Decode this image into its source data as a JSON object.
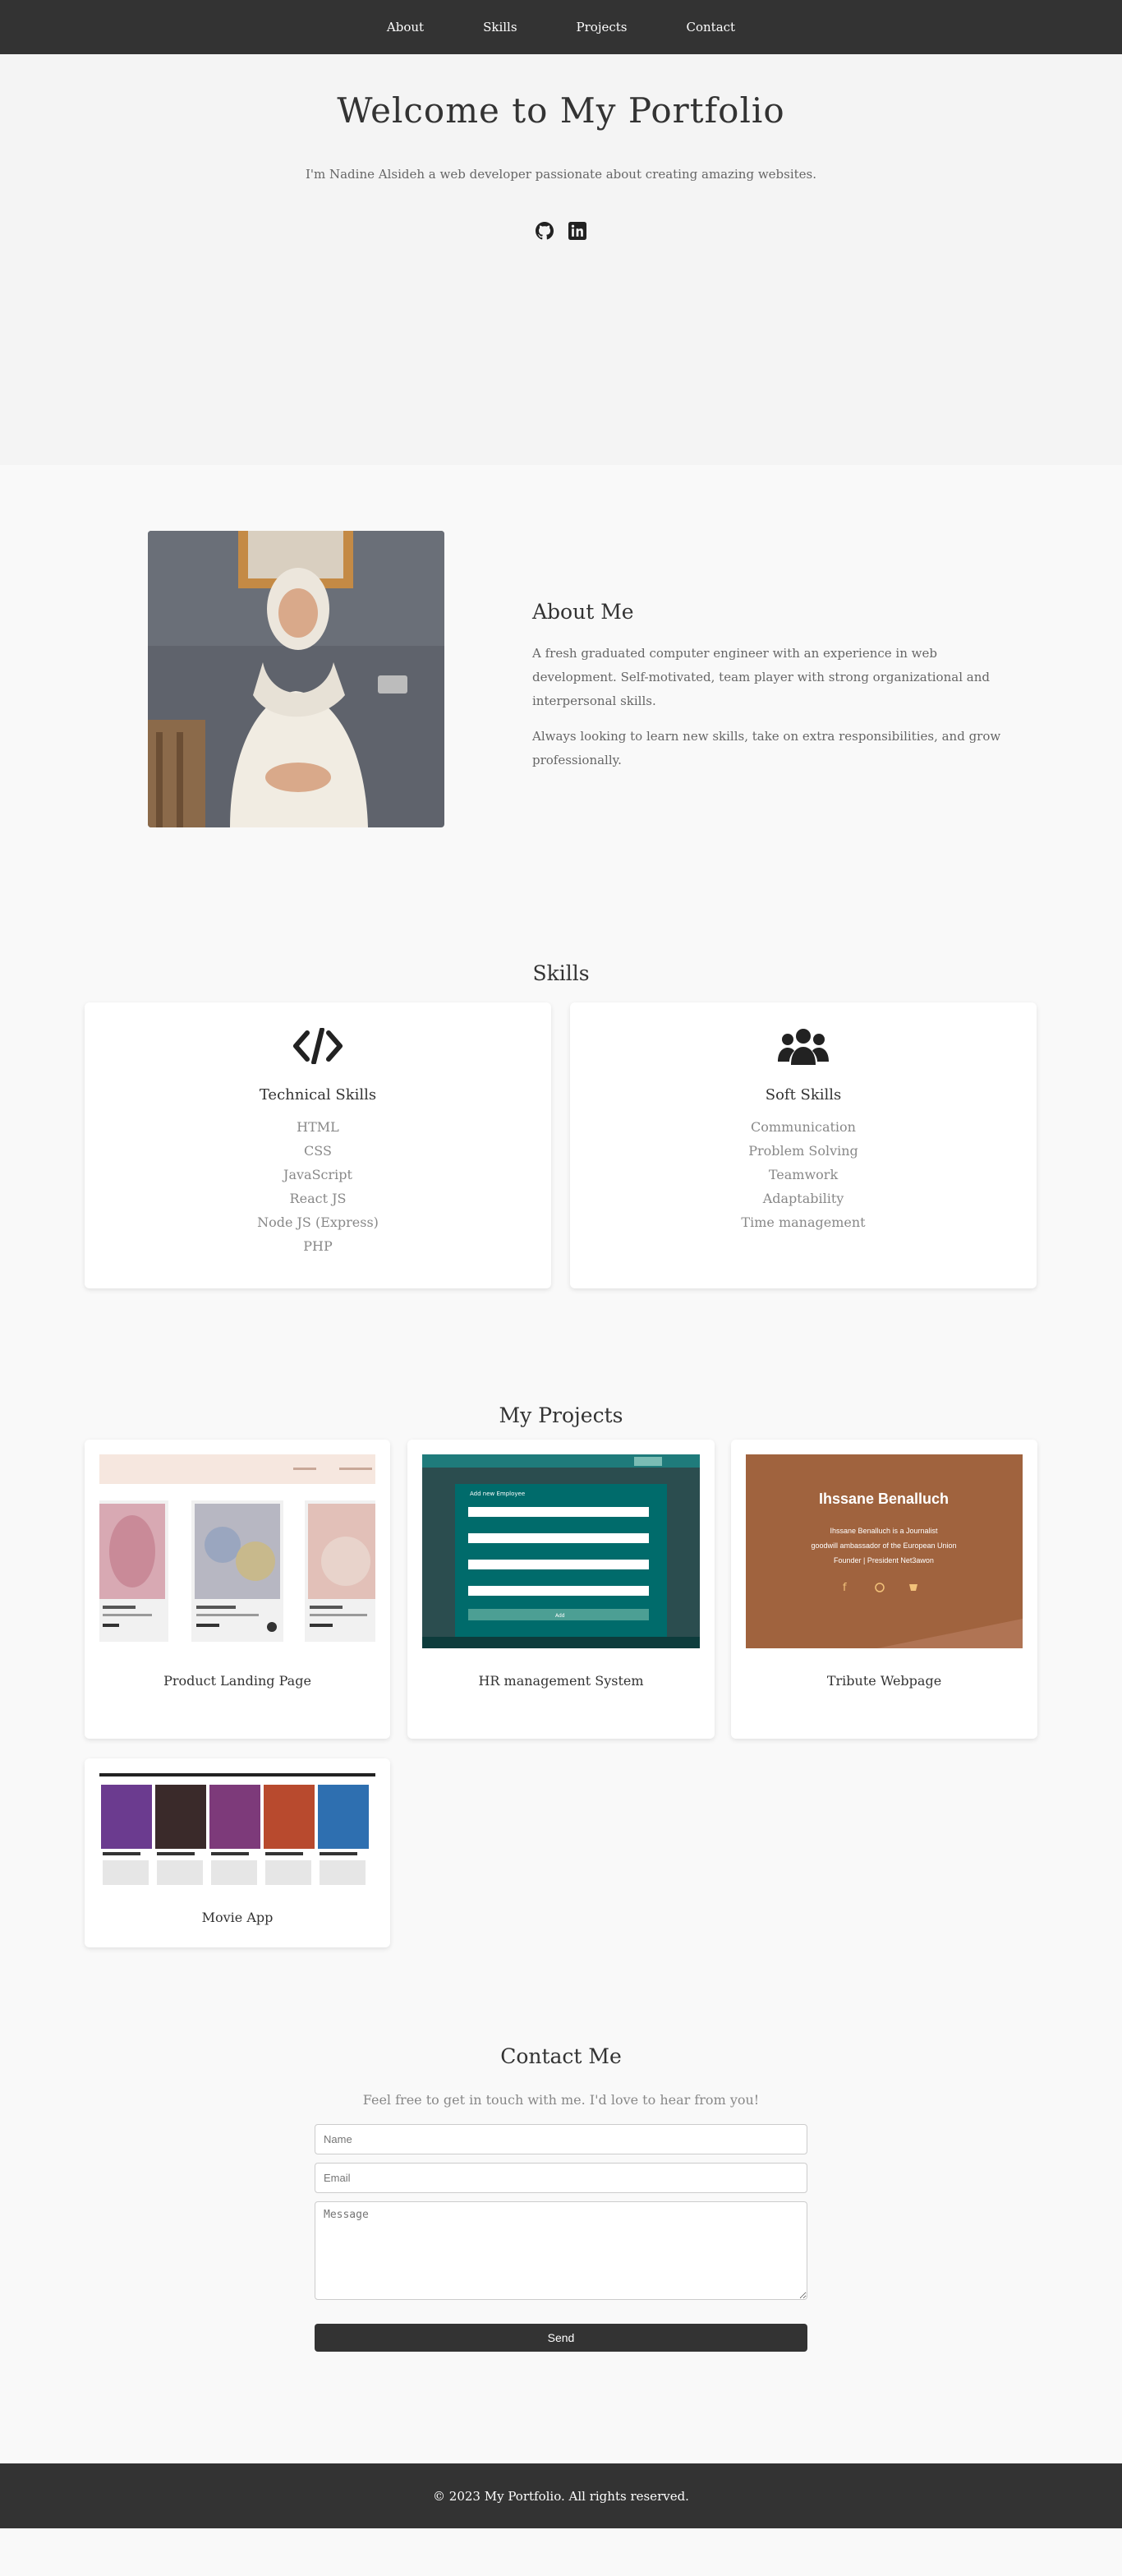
{
  "nav": {
    "items": [
      {
        "label": "About"
      },
      {
        "label": "Skills"
      },
      {
        "label": "Projects"
      },
      {
        "label": "Contact"
      }
    ]
  },
  "hero": {
    "title": "Welcome to My Portfolio",
    "subtitle": "I'm Nadine Alsideh a web developer passionate about creating amazing websites.",
    "socials": [
      "github-icon",
      "linkedin-icon"
    ]
  },
  "about": {
    "title": "About Me",
    "paragraph1": "A fresh graduated computer engineer with an experience in web development. Self-motivated, team player with strong organizational and interpersonal skills.",
    "paragraph2": "Always looking to learn new skills, take on extra responsibilities, and grow professionally."
  },
  "skills": {
    "title": "Skills",
    "technical": {
      "title": "Technical Skills",
      "icon": "code-icon",
      "items": [
        "HTML",
        "CSS",
        "JavaScript",
        "React JS",
        "Node JS (Express)",
        "PHP"
      ]
    },
    "soft": {
      "title": "Soft Skills",
      "icon": "users-icon",
      "items": [
        "Communication",
        "Problem Solving",
        "Teamwork",
        "Adaptability",
        "Time management"
      ]
    }
  },
  "projects": {
    "title": "My Projects",
    "items": [
      {
        "title": "Product Landing Page"
      },
      {
        "title": "HR management System"
      },
      {
        "title": "Tribute Webpage"
      },
      {
        "title": "Movie App"
      }
    ],
    "tribute_preview": {
      "name": "Ihssane Benalluch",
      "line1": "Ihssane Benalluch is a Journalist",
      "line2": "goodwill ambassador of the European Union",
      "line3": "Founder | President Net3awon"
    },
    "hr_preview": {
      "heading": "Add new Employee",
      "button": "Add"
    }
  },
  "contact": {
    "title": "Contact Me",
    "subtitle": "Feel free to get in touch with me. I'd love to hear from you!",
    "name_placeholder": "Name",
    "email_placeholder": "Email",
    "message_placeholder": "Message",
    "send_label": "Send"
  },
  "footer": {
    "text": "© 2023 My Portfolio. All rights reserved."
  },
  "colors": {
    "nav_bg": "#333333",
    "tribute_bg": "#a0633e",
    "hr_bg": "#006b6b",
    "landing_bg": "#f6e7df"
  }
}
